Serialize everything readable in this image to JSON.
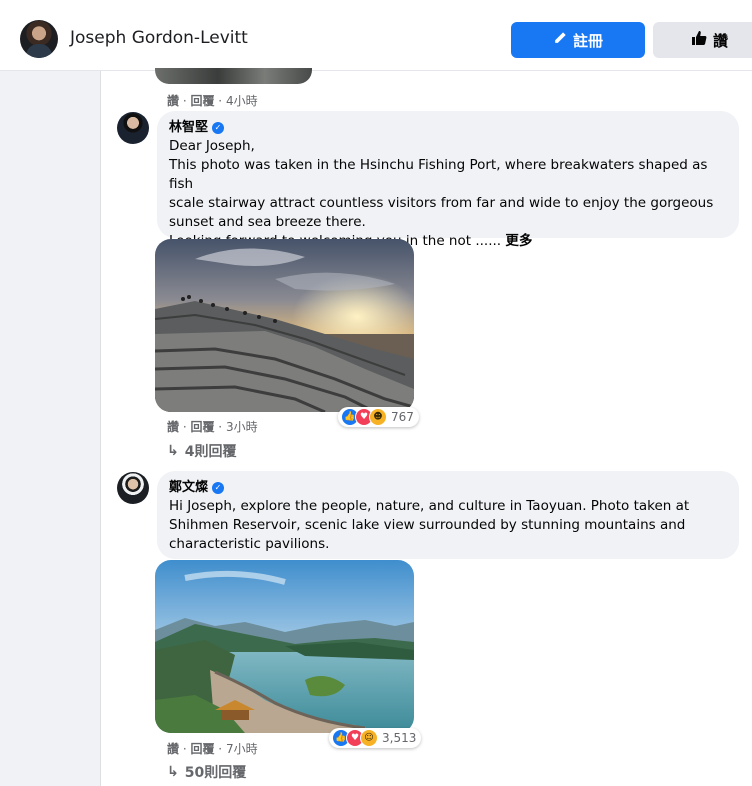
{
  "header": {
    "profile_name": "Joseph Gordon-Levitt",
    "register_label": "註冊",
    "like_label": "讚"
  },
  "previous_comment": {
    "like": "讚",
    "reply": "回覆",
    "time": "4小時"
  },
  "comments": [
    {
      "author": "林智堅",
      "lines": [
        "Dear Joseph,",
        "This photo was taken in the Hsinchu Fishing Port, where breakwaters shaped as fish",
        "scale stairway attract countless visitors from far and wide to enjoy the gorgeous",
        "sunset and sea breeze there.",
        "Looking forward to welcoming you in the not ......"
      ],
      "more_label": "更多",
      "like": "讚",
      "reply": "回覆",
      "time": "3小時",
      "reaction_count": "767",
      "reactions": [
        "like-icon",
        "love-icon",
        "haha-icon"
      ],
      "replies_label": "4則回覆"
    },
    {
      "author": "鄭文燦",
      "lines": [
        "Hi Joseph, explore the people, nature, and culture in Taoyuan. Photo taken at",
        "Shihmen Reservoir, scenic lake view surrounded by stunning mountains and",
        "characteristic pavilions."
      ],
      "like": "讚",
      "reply": "回覆",
      "time": "7小時",
      "reaction_count": "3,513",
      "reactions": [
        "like-icon",
        "love-icon",
        "care-icon"
      ],
      "replies_label": "50則回覆"
    }
  ],
  "colors": {
    "accent": "#1877f2",
    "bubble": "#f0f2f5",
    "secondary_text": "#65676b"
  }
}
